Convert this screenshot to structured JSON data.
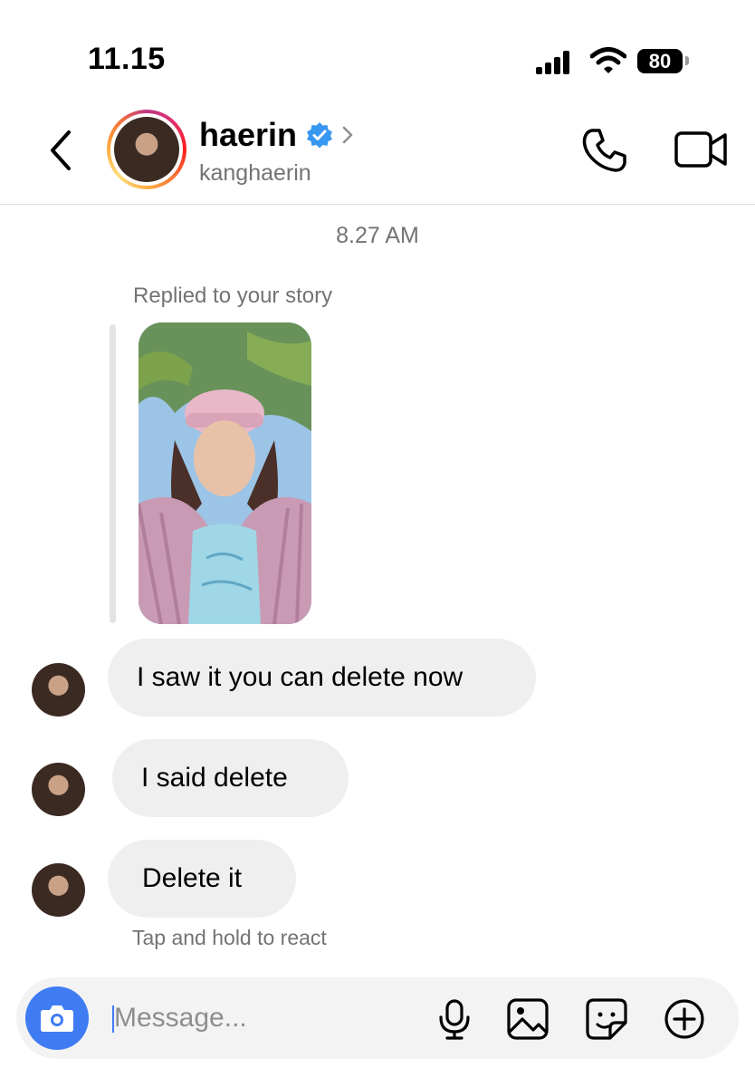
{
  "status_bar": {
    "time": "11.15",
    "battery": "80",
    "icons": [
      "signal-icon",
      "wifi-icon",
      "battery-icon"
    ]
  },
  "header": {
    "name": "haerin",
    "username": "kanghaerin",
    "verified": true,
    "icons": [
      "back-arrow-icon",
      "verified-badge-icon",
      "chevron-right-icon",
      "phone-icon",
      "video-camera-icon"
    ]
  },
  "chat": {
    "timestamp": "8.27 AM",
    "reply_label": "Replied to your story",
    "messages": [
      {
        "text": "I saw it you can delete now"
      },
      {
        "text": "I said delete"
      },
      {
        "text": "Delete it"
      }
    ],
    "react_hint": "Tap and hold to react"
  },
  "composer": {
    "placeholder": "Message...",
    "value": "",
    "icons": [
      "camera-icon",
      "microphone-icon",
      "gallery-icon",
      "sticker-icon",
      "plus-icon"
    ]
  },
  "colors": {
    "accent_blue": "#3f7cf4",
    "verified_blue": "#3897f0",
    "bubble_gray": "#efefef",
    "secondary_text": "#737373"
  }
}
